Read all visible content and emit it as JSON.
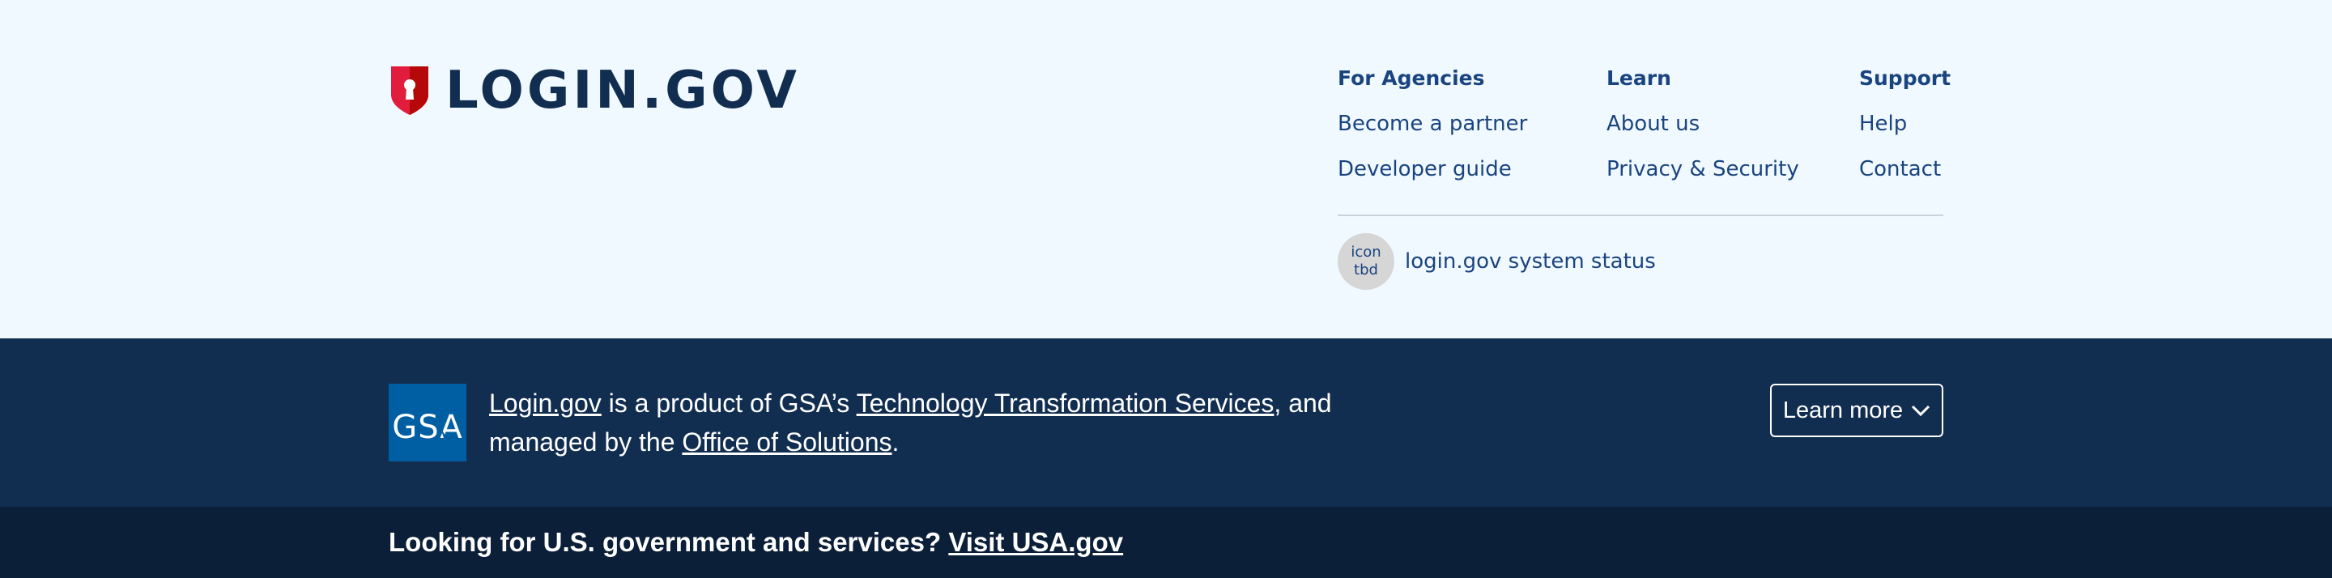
{
  "header": {
    "logo_text": "LOGIN.GOV",
    "logo_icon": "shield-keyhole-icon"
  },
  "footer_nav": {
    "columns": [
      {
        "heading": "For Agencies",
        "links": [
          "Become a partner",
          "Developer guide"
        ]
      },
      {
        "heading": "Learn",
        "links": [
          "About us",
          "Privacy & Security"
        ]
      },
      {
        "heading": "Support",
        "links": [
          "Help",
          "Contact"
        ]
      }
    ]
  },
  "status": {
    "icon_line1": "icon",
    "icon_line2": "tbd",
    "link_text": "login.gov system status"
  },
  "gsa_banner": {
    "logo_text": "GSA",
    "link_login": "Login.gov",
    "text_1": " is a product of GSA’s ",
    "link_tts": "Technology Transformation Services",
    "text_2": ", and managed by the ",
    "link_oos": "Office of Solutions",
    "text_3": ".",
    "learn_more_label": "Learn more"
  },
  "gov_banner": {
    "text": "Looking for U.S. government and services? ",
    "link_text": "Visit USA.gov"
  },
  "colors": {
    "navy": "#112e51",
    "link_blue": "#1a4480",
    "light_bg": "#f0f9ff",
    "dark_bg": "#0b1f38",
    "shield_red": "#e21c3d",
    "gsa_blue": "#005ea2"
  }
}
